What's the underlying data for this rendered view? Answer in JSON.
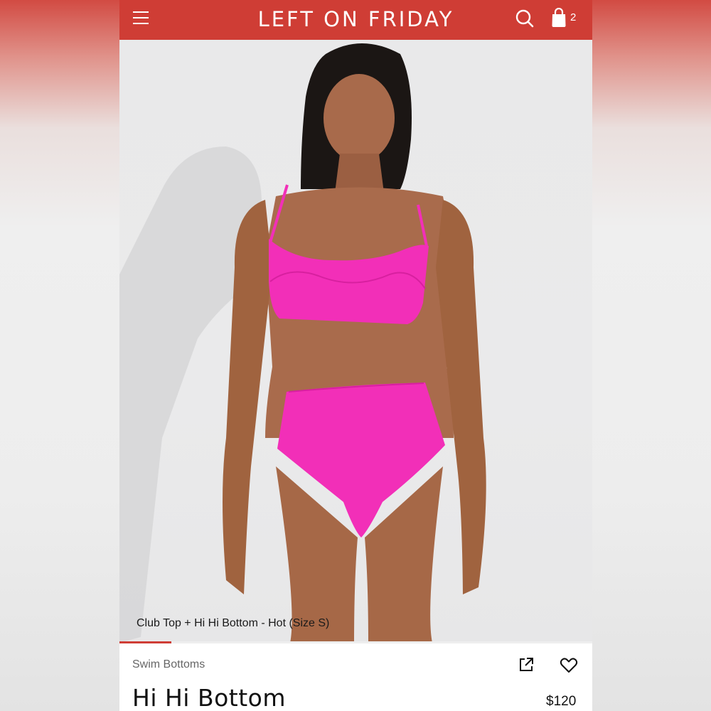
{
  "header": {
    "brand": "LEFT ON FRIDAY",
    "cart_count": "2",
    "bg_color": "#cf3d35",
    "icons": [
      "menu-icon",
      "search-icon",
      "shopping-bag-icon"
    ]
  },
  "hero": {
    "caption": "Club Top + Hi Hi Bottom - Hot (Size S)",
    "gallery_progress": 0.11
  },
  "product": {
    "category": "Swim Bottoms",
    "title": "Hi Hi Bottom",
    "price": "$120",
    "icons": [
      "share-icon",
      "heart-icon"
    ],
    "swimsuit_color": "#f22fb8"
  }
}
